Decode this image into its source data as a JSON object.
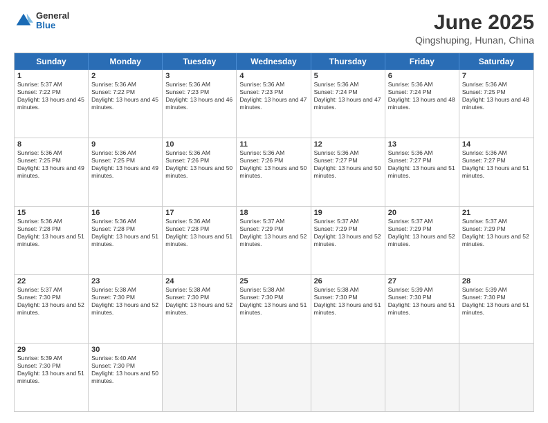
{
  "header": {
    "logo": {
      "line1": "General",
      "line2": "Blue"
    },
    "title": "June 2025",
    "subtitle": "Qingshuping, Hunan, China"
  },
  "calendar": {
    "days": [
      "Sunday",
      "Monday",
      "Tuesday",
      "Wednesday",
      "Thursday",
      "Friday",
      "Saturday"
    ],
    "rows": [
      [
        {
          "day": "1",
          "sunrise": "5:37 AM",
          "sunset": "7:22 PM",
          "daylight": "13 hours and 45 minutes."
        },
        {
          "day": "2",
          "sunrise": "5:36 AM",
          "sunset": "7:22 PM",
          "daylight": "13 hours and 45 minutes."
        },
        {
          "day": "3",
          "sunrise": "5:36 AM",
          "sunset": "7:23 PM",
          "daylight": "13 hours and 46 minutes."
        },
        {
          "day": "4",
          "sunrise": "5:36 AM",
          "sunset": "7:23 PM",
          "daylight": "13 hours and 47 minutes."
        },
        {
          "day": "5",
          "sunrise": "5:36 AM",
          "sunset": "7:24 PM",
          "daylight": "13 hours and 47 minutes."
        },
        {
          "day": "6",
          "sunrise": "5:36 AM",
          "sunset": "7:24 PM",
          "daylight": "13 hours and 48 minutes."
        },
        {
          "day": "7",
          "sunrise": "5:36 AM",
          "sunset": "7:25 PM",
          "daylight": "13 hours and 48 minutes."
        }
      ],
      [
        {
          "day": "8",
          "sunrise": "5:36 AM",
          "sunset": "7:25 PM",
          "daylight": "13 hours and 49 minutes."
        },
        {
          "day": "9",
          "sunrise": "5:36 AM",
          "sunset": "7:25 PM",
          "daylight": "13 hours and 49 minutes."
        },
        {
          "day": "10",
          "sunrise": "5:36 AM",
          "sunset": "7:26 PM",
          "daylight": "13 hours and 50 minutes."
        },
        {
          "day": "11",
          "sunrise": "5:36 AM",
          "sunset": "7:26 PM",
          "daylight": "13 hours and 50 minutes."
        },
        {
          "day": "12",
          "sunrise": "5:36 AM",
          "sunset": "7:27 PM",
          "daylight": "13 hours and 50 minutes."
        },
        {
          "day": "13",
          "sunrise": "5:36 AM",
          "sunset": "7:27 PM",
          "daylight": "13 hours and 51 minutes."
        },
        {
          "day": "14",
          "sunrise": "5:36 AM",
          "sunset": "7:27 PM",
          "daylight": "13 hours and 51 minutes."
        }
      ],
      [
        {
          "day": "15",
          "sunrise": "5:36 AM",
          "sunset": "7:28 PM",
          "daylight": "13 hours and 51 minutes."
        },
        {
          "day": "16",
          "sunrise": "5:36 AM",
          "sunset": "7:28 PM",
          "daylight": "13 hours and 51 minutes."
        },
        {
          "day": "17",
          "sunrise": "5:36 AM",
          "sunset": "7:28 PM",
          "daylight": "13 hours and 51 minutes."
        },
        {
          "day": "18",
          "sunrise": "5:37 AM",
          "sunset": "7:29 PM",
          "daylight": "13 hours and 52 minutes."
        },
        {
          "day": "19",
          "sunrise": "5:37 AM",
          "sunset": "7:29 PM",
          "daylight": "13 hours and 52 minutes."
        },
        {
          "day": "20",
          "sunrise": "5:37 AM",
          "sunset": "7:29 PM",
          "daylight": "13 hours and 52 minutes."
        },
        {
          "day": "21",
          "sunrise": "5:37 AM",
          "sunset": "7:29 PM",
          "daylight": "13 hours and 52 minutes."
        }
      ],
      [
        {
          "day": "22",
          "sunrise": "5:37 AM",
          "sunset": "7:30 PM",
          "daylight": "13 hours and 52 minutes."
        },
        {
          "day": "23",
          "sunrise": "5:38 AM",
          "sunset": "7:30 PM",
          "daylight": "13 hours and 52 minutes."
        },
        {
          "day": "24",
          "sunrise": "5:38 AM",
          "sunset": "7:30 PM",
          "daylight": "13 hours and 52 minutes."
        },
        {
          "day": "25",
          "sunrise": "5:38 AM",
          "sunset": "7:30 PM",
          "daylight": "13 hours and 51 minutes."
        },
        {
          "day": "26",
          "sunrise": "5:38 AM",
          "sunset": "7:30 PM",
          "daylight": "13 hours and 51 minutes."
        },
        {
          "day": "27",
          "sunrise": "5:39 AM",
          "sunset": "7:30 PM",
          "daylight": "13 hours and 51 minutes."
        },
        {
          "day": "28",
          "sunrise": "5:39 AM",
          "sunset": "7:30 PM",
          "daylight": "13 hours and 51 minutes."
        }
      ],
      [
        {
          "day": "29",
          "sunrise": "5:39 AM",
          "sunset": "7:30 PM",
          "daylight": "13 hours and 51 minutes."
        },
        {
          "day": "30",
          "sunrise": "5:40 AM",
          "sunset": "7:30 PM",
          "daylight": "13 hours and 50 minutes."
        },
        null,
        null,
        null,
        null,
        null
      ]
    ]
  }
}
